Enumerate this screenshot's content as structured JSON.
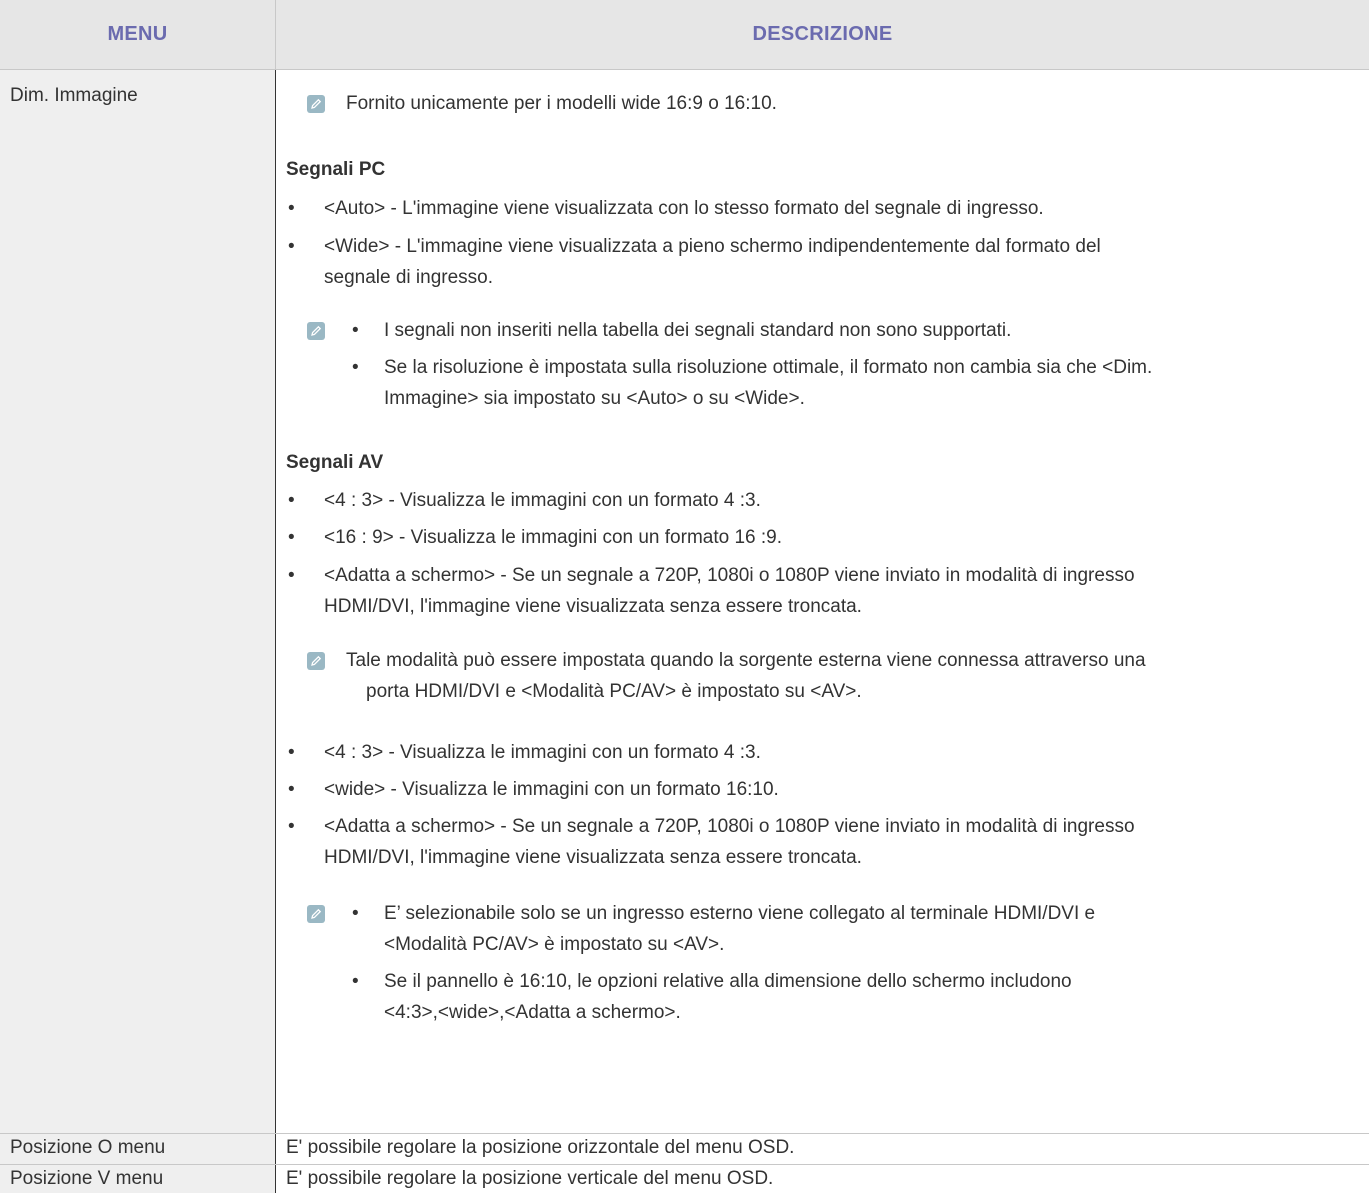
{
  "header": {
    "menu": "MENU",
    "description": "DESCRIZIONE"
  },
  "rows": [
    {
      "menu": "Dim. Immagine",
      "note_top": "Fornito unicamente per i modelli wide 16:9 o 16:10.",
      "pc": {
        "heading": "Segnali PC",
        "items": [
          "<Auto> - L'immagine viene visualizzata con lo stesso formato del segnale di ingresso.",
          "<Wide> - L'immagine viene visualizzata a pieno schermo indipendentemente dal formato del",
          "segnale di ingresso."
        ],
        "notes": [
          "I segnali non inseriti nella tabella dei segnali standard non sono supportati.",
          "Se la risoluzione è impostata sulla risoluzione ottimale, il formato non cambia sia che <Dim.",
          "Immagine> sia impostato su <Auto> o su <Wide>."
        ]
      },
      "av": {
        "heading": "Segnali AV",
        "items1": [
          "<4 : 3> - Visualizza le immagini con un formato 4 :3.",
          "<16 : 9> - Visualizza le immagini con un formato 16 :9.",
          "<Adatta a schermo> - Se un segnale a 720P, 1080i o 1080P viene inviato in modalità di ingresso",
          "HDMI/DVI, l'immagine viene visualizzata senza essere troncata."
        ],
        "note_mid": [
          "Tale modalità può essere impostata quando la sorgente esterna viene connessa attraverso una",
          "porta HDMI/DVI e <Modalità PC/AV> è impostato su <AV>."
        ],
        "items2": [
          "<4 : 3> - Visualizza le immagini con un formato 4 :3.",
          "<wide> - Visualizza le immagini con un formato 16:10.",
          "<Adatta a schermo> - Se un segnale a 720P, 1080i o 1080P viene inviato in modalità di ingresso",
          "HDMI/DVI, l'immagine viene visualizzata senza essere troncata."
        ],
        "notes_end": [
          "E’ selezionabile solo se un ingresso esterno viene collegato al terminale HDMI/DVI e",
          "<Modalità PC/AV> è impostato su <AV>.",
          "Se il pannello è 16:10, le opzioni relative alla dimensione dello schermo includono",
          "<4:3>,<wide>,<Adatta a schermo>."
        ]
      }
    },
    {
      "menu": "Posizione O menu",
      "description": "E' possibile regolare la posizione orizzontale del menu OSD."
    },
    {
      "menu": "Posizione V menu",
      "description": "E' possibile regolare la posizione verticale del menu OSD."
    }
  ],
  "bullet_char": "•",
  "icon": "note-pencil-icon"
}
